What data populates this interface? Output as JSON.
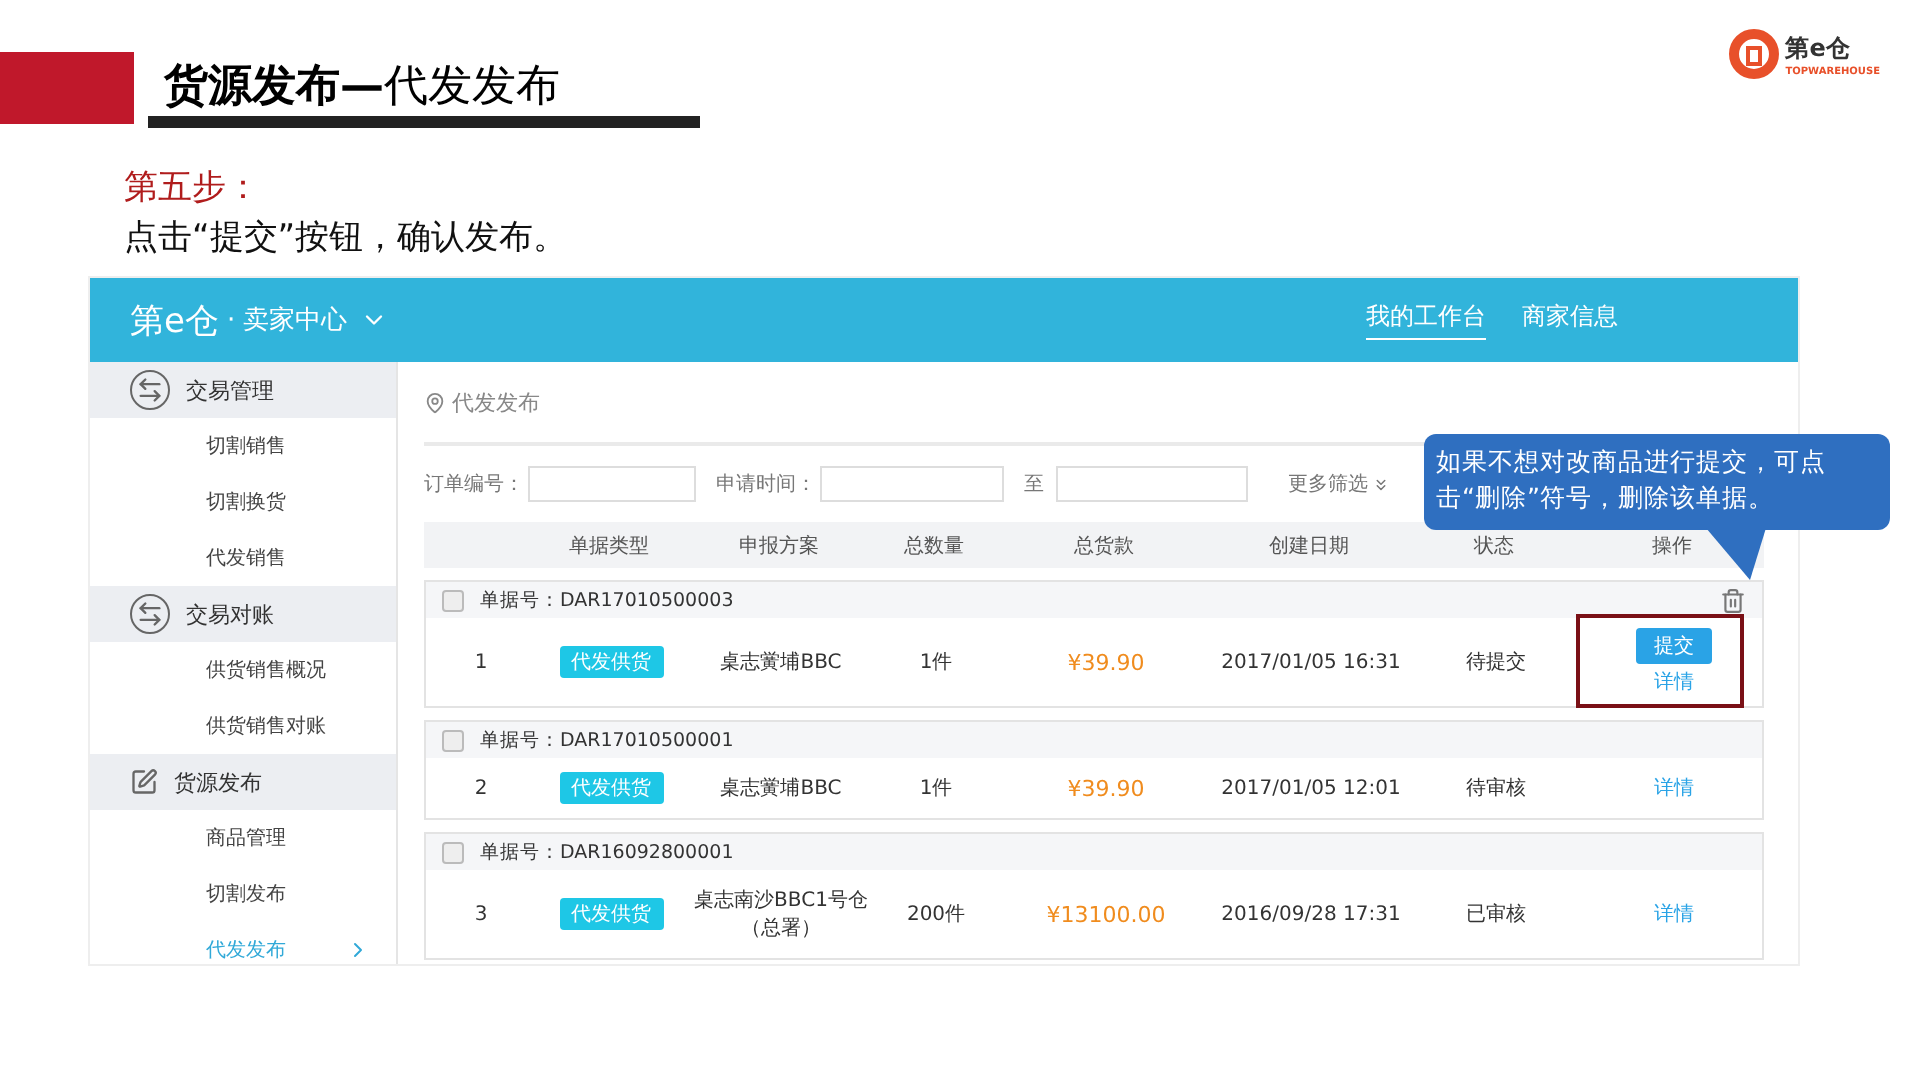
{
  "slide": {
    "title": "**货源发布—**代发发布",
    "logo": {
      "name": "第e仓",
      "tagline": "TOPWAREHOUSE"
    },
    "step_label": "第五步：",
    "instruction": "点击“提交”按钮，确认发布。"
  },
  "app": {
    "brand": "第e仓",
    "brand_suffix": "· 卖家中心",
    "nav": [
      {
        "label": "我的工作台",
        "selected": true
      },
      {
        "label": "商家信息",
        "selected": false
      }
    ],
    "sidebar": [
      {
        "label": "交易管理",
        "items": [
          {
            "label": "切割销售",
            "selected": false
          },
          {
            "label": "切割换货",
            "selected": false
          },
          {
            "label": "代发销售",
            "selected": false
          }
        ]
      },
      {
        "label": "交易对账",
        "items": [
          {
            "label": "供货销售概况",
            "selected": false
          },
          {
            "label": "供货销售对账",
            "selected": false
          }
        ]
      },
      {
        "label": "货源发布",
        "items": [
          {
            "label": "商品管理",
            "selected": false
          },
          {
            "label": "切割发布",
            "selected": false
          },
          {
            "label": "代发发布",
            "selected": true
          }
        ]
      }
    ],
    "breadcrumb": "代发发布",
    "filters": {
      "order_no_label": "订单编号：",
      "date_label": "申请时间：",
      "range_sep": "至",
      "more": "更多筛选"
    },
    "columns": [
      "单据类型",
      "申报方案",
      "总数量",
      "总货款",
      "创建日期",
      "状态",
      "操作"
    ],
    "orders": [
      {
        "number": "单据号：DAR17010500003",
        "checked": false,
        "deletable": true,
        "index": "1",
        "type": "代发供货",
        "plan": "桌志黉埔BBC",
        "qty": "1件",
        "amount": "¥39.90",
        "date": "2017/01/05 16:31",
        "status": "待提交",
        "highlighted": true,
        "actions": [
          {
            "kind": "button",
            "label": "提交"
          },
          {
            "kind": "link",
            "label": "详情"
          }
        ]
      },
      {
        "number": "单据号：DAR17010500001",
        "checked": false,
        "deletable": false,
        "index": "2",
        "type": "代发供货",
        "plan": "桌志黉埔BBC",
        "qty": "1件",
        "amount": "¥39.90",
        "date": "2017/01/05 12:01",
        "status": "待审核",
        "highlighted": false,
        "actions": [
          {
            "kind": "link",
            "label": "详情"
          }
        ]
      },
      {
        "number": "单据号：DAR16092800001",
        "checked": false,
        "deletable": false,
        "index": "3",
        "type": "代发供货",
        "plan": "桌志南沙BBC1号仓",
        "plan_note": "（总署）",
        "qty": "200件",
        "amount": "¥13100.00",
        "date": "2016/09/28 17:31",
        "status": "已审核",
        "highlighted": false,
        "actions": [
          {
            "kind": "link",
            "label": "详情"
          }
        ]
      }
    ]
  },
  "callout": "如果不想对改商品进行提交，可点击“删除”符号，删除该单据。"
}
